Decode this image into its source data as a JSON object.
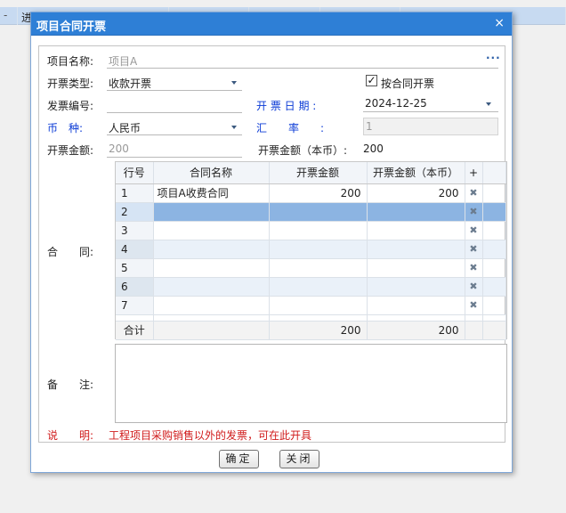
{
  "background": {
    "partial_text": "进",
    "tick": "-"
  },
  "dialog": {
    "title": "项目合同开票",
    "close_glyph": "×",
    "fields": {
      "project_name_label": "项目名称:",
      "project_name_value": "项目A",
      "ellipsis": "···",
      "invoice_type_label": "开票类型:",
      "invoice_type_value": "收款开票",
      "by_contract_label": "按合同开票",
      "by_contract_checked": true,
      "check_glyph": "✓",
      "invoice_no_label": "发票编号:",
      "invoice_no_value": "",
      "invoice_date_label": "开 票 日 期 :",
      "invoice_date_value": "2024-12-25",
      "currency_label": "币　种:",
      "currency_value": "人民币",
      "exchange_rate_label": "汇　　率　　:",
      "exchange_rate_value": "1",
      "amount_label": "开票金额:",
      "amount_value": "200",
      "amount_local_label": "开票金额（本币）:",
      "amount_local_value": "200",
      "contract_label": "合　　同:",
      "memo_label": "备　　注:",
      "memo_value": "",
      "note_label": "说　　明:",
      "note_text": "工程项目采购销售以外的发票，可在此开具"
    },
    "grid": {
      "headers": {
        "row_no": "行号",
        "name": "合同名称",
        "amount": "开票金额",
        "amount_local": "开票金额（本币）",
        "add": "+"
      },
      "rows": [
        {
          "no": "1",
          "name": "项目A收费合同",
          "amount": "200",
          "amount_local": "200"
        },
        {
          "no": "2",
          "name": "",
          "amount": "",
          "amount_local": ""
        },
        {
          "no": "3",
          "name": "",
          "amount": "",
          "amount_local": ""
        },
        {
          "no": "4",
          "name": "",
          "amount": "",
          "amount_local": ""
        },
        {
          "no": "5",
          "name": "",
          "amount": "",
          "amount_local": ""
        },
        {
          "no": "6",
          "name": "",
          "amount": "",
          "amount_local": ""
        },
        {
          "no": "7",
          "name": "",
          "amount": "",
          "amount_local": ""
        }
      ],
      "selected_row": "2",
      "delete_glyph": "✖",
      "total": {
        "label": "合计",
        "amount": "200",
        "amount_local": "200"
      }
    },
    "buttons": {
      "ok": "确定",
      "close": "关闭"
    }
  }
}
